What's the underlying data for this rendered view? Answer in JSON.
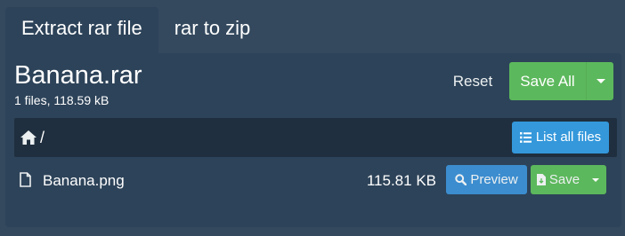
{
  "tabs": [
    {
      "label": "Extract rar file",
      "active": true
    },
    {
      "label": "rar to zip",
      "active": false
    }
  ],
  "archive": {
    "title": "Banana.rar",
    "meta": "1 files, 118.59 kB"
  },
  "toolbar": {
    "reset_label": "Reset",
    "save_all_label": "Save All"
  },
  "path": {
    "separator": "/",
    "list_all_label": "List all files"
  },
  "files": [
    {
      "name": "Banana.png",
      "size": "115.81 KB",
      "preview_label": "Preview",
      "save_label": "Save"
    }
  ],
  "colors": {
    "background": "#34495e",
    "panel": "#2d4359",
    "pathbar": "#1f2f3f",
    "primary": "#3498db",
    "success": "#5cb85c"
  },
  "icons": [
    "home-icon",
    "list-icon",
    "file-icon",
    "search-icon",
    "file-save-icon",
    "caret-down-icon"
  ]
}
